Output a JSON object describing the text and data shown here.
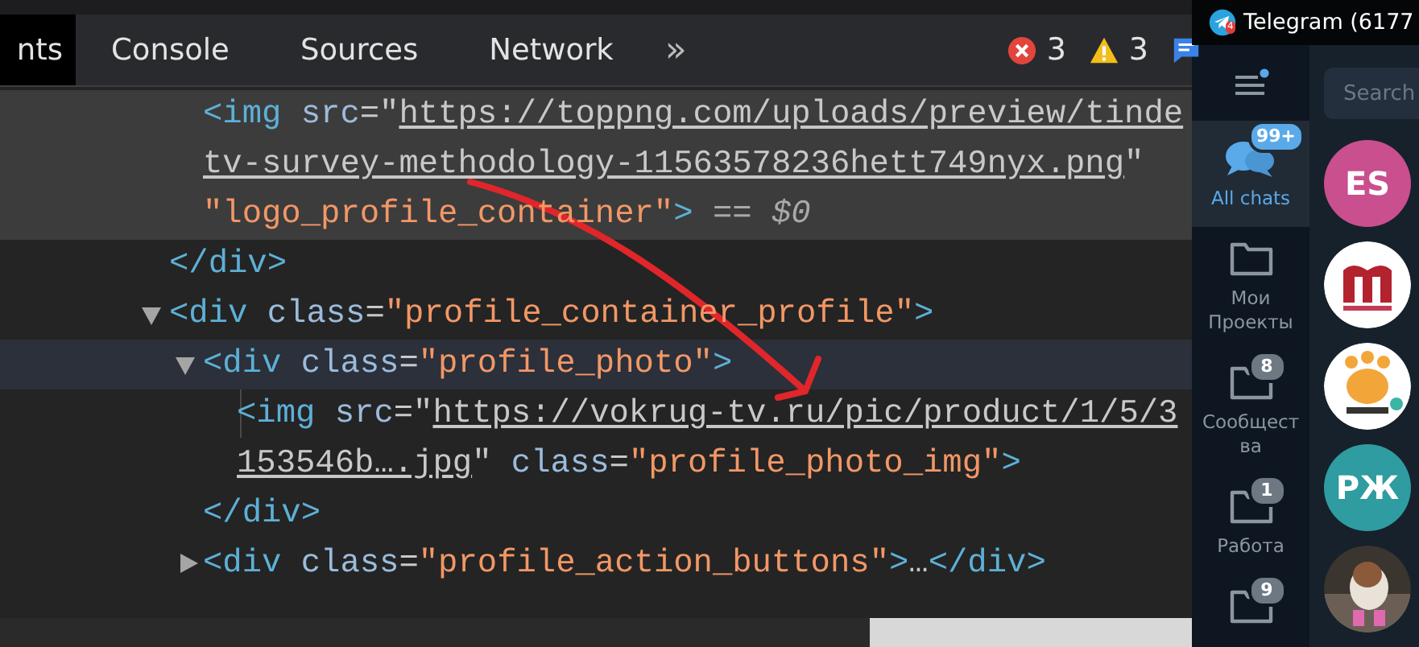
{
  "devtools": {
    "tabs": [
      {
        "label": "nts",
        "selected": true
      },
      {
        "label": "Console",
        "selected": false
      },
      {
        "label": "Sources",
        "selected": false
      },
      {
        "label": "Network",
        "selected": false
      }
    ],
    "overflow": "»",
    "counters": [
      {
        "kind": "error",
        "count": "3"
      },
      {
        "kind": "warning",
        "count": "3"
      },
      {
        "kind": "message"
      }
    ],
    "dom_tree": [
      {
        "children": [
          {
            "selected": true,
            "hovered": false,
            "lines": [
              [
                {
                  "kind": "tag",
                  "text": "<img"
                },
                {
                  "kind": "attr",
                  "text": " src"
                },
                {
                  "kind": "punct",
                  "text": "=\""
                },
                {
                  "kind": "link",
                  "text": "https://toppng.com/uploads/preview/tinde"
                }
              ],
              [
                {
                  "kind": "link",
                  "text": "tv-survey-methodology-11563578236hett749nyx.png"
                },
                {
                  "kind": "punct",
                  "text": "\""
                }
              ],
              [
                {
                  "kind": "string",
                  "text": "\"logo_profile_container\""
                },
                {
                  "kind": "tag",
                  "text": ">"
                },
                {
                  "kind": "marker",
                  "text": " == *$0*"
                }
              ]
            ]
          }
        ]
      },
      {
        "selected": false,
        "hovered": false,
        "lines": [
          [
            {
              "kind": "tag",
              "text": "</div>"
            }
          ]
        ]
      },
      {
        "selected": false,
        "hovered": false,
        "expanded": true,
        "lines": [
          [
            {
              "kind": "tag",
              "text": "<div"
            },
            {
              "kind": "attr",
              "text": " class"
            },
            {
              "kind": "punct",
              "text": "="
            },
            {
              "kind": "string",
              "text": "\"profile_container_profile\""
            },
            {
              "kind": "tag",
              "text": ">"
            }
          ]
        ],
        "children": [
          {
            "selected": false,
            "hovered": true,
            "expanded": true,
            "lines": [
              [
                {
                  "kind": "tag",
                  "text": "<div"
                },
                {
                  "kind": "attr",
                  "text": " class"
                },
                {
                  "kind": "punct",
                  "text": "="
                },
                {
                  "kind": "string",
                  "text": "\"profile_photo\""
                },
                {
                  "kind": "tag",
                  "text": ">"
                }
              ]
            ],
            "children": [
              {
                "selected": false,
                "hovered": false,
                "lines": [
                  [
                    {
                      "kind": "tag",
                      "text": "<img"
                    },
                    {
                      "kind": "attr",
                      "text": " src"
                    },
                    {
                      "kind": "punct",
                      "text": "=\""
                    },
                    {
                      "kind": "link",
                      "text": "https://vokrug-tv.ru/pic/product/1/5/3"
                    }
                  ],
                  [
                    {
                      "kind": "link",
                      "text": "153546b….jpg"
                    },
                    {
                      "kind": "punct",
                      "text": "\""
                    },
                    {
                      "kind": "attr",
                      "text": " class"
                    },
                    {
                      "kind": "punct",
                      "text": "="
                    },
                    {
                      "kind": "string",
                      "text": "\"profile_photo_img\""
                    },
                    {
                      "kind": "tag",
                      "text": ">"
                    }
                  ]
                ]
              }
            ]
          },
          {
            "selected": false,
            "hovered": false,
            "lines": [
              [
                {
                  "kind": "tag",
                  "text": "</div>"
                }
              ]
            ]
          },
          {
            "selected": false,
            "hovered": false,
            "expanded": false,
            "lines": [
              [
                {
                  "kind": "tag",
                  "text": "<div"
                },
                {
                  "kind": "attr",
                  "text": " class"
                },
                {
                  "kind": "punct",
                  "text": "="
                },
                {
                  "kind": "string",
                  "text": "\"profile_action_buttons\""
                },
                {
                  "kind": "tag",
                  "text": ">"
                },
                {
                  "kind": "plain",
                  "text": "…"
                },
                {
                  "kind": "tag",
                  "text": "</div>"
                }
              ]
            ]
          }
        ]
      }
    ]
  },
  "telegram": {
    "window": {
      "title": "Telegram (6177",
      "badge": "4"
    },
    "folders": [
      {
        "label": "All chats",
        "badge": "99+",
        "kind": "chats",
        "selected": true
      },
      {
        "label": "Мои Проекты",
        "kind": "folder",
        "selected": false
      },
      {
        "label": "Сообщества",
        "badge": "8",
        "kind": "folder",
        "selected": false
      },
      {
        "label": "Работа",
        "badge": "1",
        "kind": "folder",
        "selected": false
      },
      {
        "badge": "9",
        "kind": "folder",
        "selected": false
      }
    ],
    "search": {
      "placeholder": "Search"
    },
    "chats": [
      {
        "kind": "initials",
        "initials": "ES",
        "color": "#c94f8e"
      },
      {
        "kind": "picture"
      },
      {
        "kind": "picture"
      },
      {
        "kind": "initials",
        "initials": "РЖ",
        "color": "#2e9ca0"
      },
      {
        "kind": "picture"
      }
    ]
  }
}
